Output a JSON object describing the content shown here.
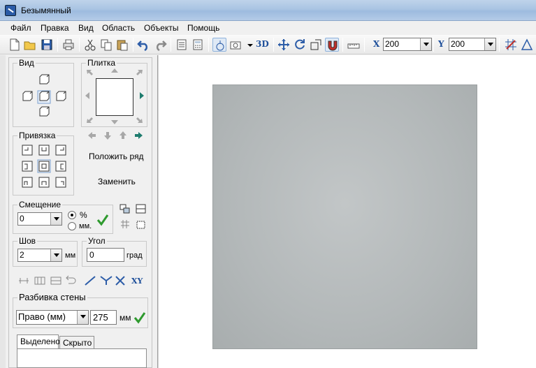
{
  "window": {
    "title": "Безымянный"
  },
  "menu": [
    "Файл",
    "Правка",
    "Вид",
    "Область",
    "Объекты",
    "Помощь"
  ],
  "toolbar": {
    "three_d_label": "3D",
    "x_label": "X",
    "x_value": "200",
    "y_label": "Y",
    "y_value": "200"
  },
  "panel": {
    "view_group": "Вид",
    "tile_group": "Плитка",
    "snap_group": "Привязка",
    "lay_row": "Положить ряд",
    "replace": "Заменить",
    "offset_group": "Смещение",
    "offset_value": "0",
    "percent_label": "%",
    "mm_label": "мм.",
    "seam_group": "Шов",
    "seam_value": "2",
    "seam_unit": "мм",
    "angle_group": "Угол",
    "angle_value": "0",
    "angle_unit": "град",
    "xy_label": "XY",
    "wall_split_group": "Разбивка стены",
    "wall_split_option": "Право (мм)",
    "wall_split_value": "275",
    "wall_split_unit": "мм",
    "tabs": [
      "Выделено",
      "Скрыто"
    ]
  },
  "colors": {
    "accent": "#1e4f9a",
    "green_check": "#2e9a2e",
    "wall": "#b3b8b9"
  }
}
